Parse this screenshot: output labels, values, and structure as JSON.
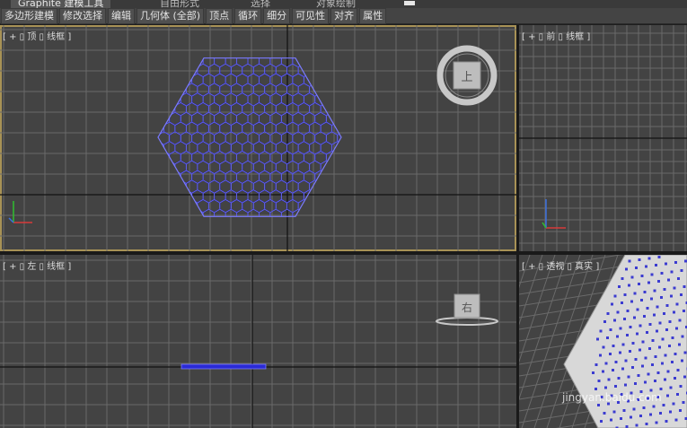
{
  "ribbon": {
    "tabs": [
      {
        "label": "Graphite 建模工具",
        "active": true
      },
      {
        "label": "自由形式",
        "active": false
      },
      {
        "label": "选择",
        "active": false
      },
      {
        "label": "对象绘制",
        "active": false
      }
    ]
  },
  "toolbar": {
    "buttons": [
      "多边形建模",
      "修改选择",
      "编辑",
      "几何体 (全部)",
      "顶点",
      "循环",
      "细分",
      "可见性",
      "对齐",
      "属性"
    ]
  },
  "viewports": {
    "top": {
      "label": "[ + ▯ 顶 ▯ 线框 ]",
      "viewcube_face": "上"
    },
    "front": {
      "label": "[ + ▯ 前 ▯ 线框 ]"
    },
    "left": {
      "label": "[ + ▯ 左 ▯ 线框 ]",
      "viewcube_face": "右"
    },
    "perspective": {
      "label": "[ + ▯ 透视 ▯ 真实 ]",
      "watermark": "jingyan.baidu.com"
    }
  },
  "colors": {
    "viewport_bg": "#434343",
    "grid": "#6a6a6a",
    "grid_axis": "#111111",
    "active_border": "#a89256",
    "wire": "#2a2ad6",
    "wire_highlight": "#ffffff",
    "vertex": "#3b3bd0",
    "shaded_surface": "#d8d8d8",
    "axis_x": "#d83a3a",
    "axis_y": "#2fbf2f",
    "axis_z": "#3a6fe0"
  }
}
